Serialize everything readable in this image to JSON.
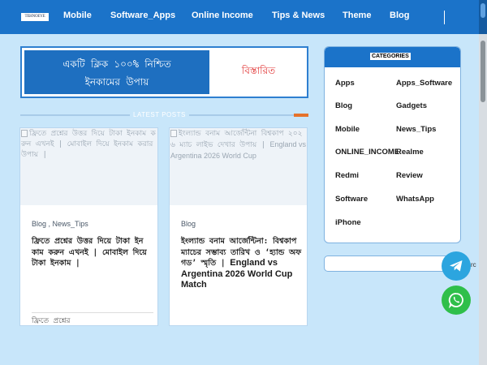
{
  "nav": {
    "logo_text": "TEHNOEYE",
    "items": [
      "Mobile",
      "Software_Apps",
      "Online Income",
      "Tips & News",
      "Theme",
      "Blog"
    ]
  },
  "banner": {
    "left_line1": "একটি ক্লিক ১০০% নিশ্চিত",
    "left_line2": "ইনকামের উপায়",
    "right_text": "বিস্তারিত"
  },
  "latest_posts": {
    "title": "LATEST POSTS"
  },
  "posts": [
    {
      "thumb_alt": "ফ্রিতে প্রশ্নের উত্তর দিয়ে টাকা ইনকাম করুন এখনই | মোবাইল দিয়ে ইনকাম করার উপায় |",
      "categories": "Blog , News_Tips",
      "title": "ফ্রিতে প্রশ্নের উত্তর দিয়ে টাকা ইনকাম করুন এখনই | মোবাইল দিয়ে টাকা ইনকাম |",
      "excerpt": "ফ্রিতে প্রশ্নের"
    },
    {
      "thumb_alt_1": "ইংল্যান্ড বনাম আর্জেন্টিনা বিশ্বকাপ ২০২৬ ম্যাচ লাইভ দেখার উপায় | ",
      "thumb_alt_2": "England vs Argentina 2026 World Cup",
      "categories": "Blog",
      "title_bn": "ইংল্যান্ড বনাম আর্জেন্টিনা: বিশ্বকাপ ম্যাচের সম্ভাব্য তারিখ ও ‘হ্যান্ড অফ গড’ স্মৃতি | ",
      "title_en": "England vs Argentina 2026 World Cup Match"
    }
  ],
  "categories_widget": {
    "title": "CATEGORIES",
    "left": [
      "Apps",
      "Blog",
      "Mobile",
      "ONLINE_INCOME",
      "Redmi",
      "Software",
      "iPhone"
    ],
    "right": [
      "Apps_Software",
      "Gadgets",
      "News_Tips",
      "Realme",
      "Review",
      "WhatsApp"
    ]
  },
  "floating": {
    "telegram_edge": "rc"
  },
  "colors": {
    "nav": "#1b73c9",
    "accent": "#e5722a",
    "page_bg": "#c8e6fa"
  }
}
